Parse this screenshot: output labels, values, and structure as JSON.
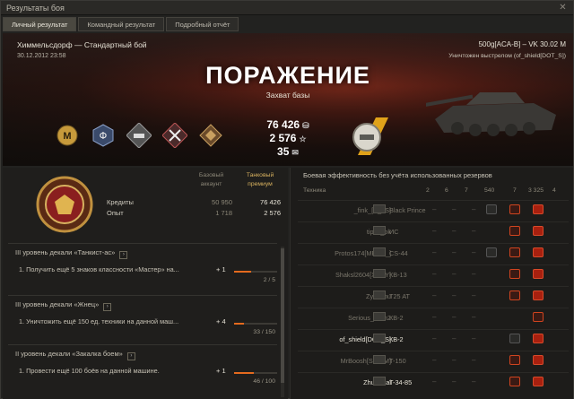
{
  "window": {
    "title": "Результаты боя"
  },
  "tabs": [
    "Личный результат",
    "Командный результат",
    "Подробный отчёт"
  ],
  "banner": {
    "map_mode": "Химмельсдорф — Стандартный бой",
    "datetime": "30.12.2012 23:58",
    "vehicle": "500g[ACA-B] – VK 30.02 M",
    "killed_by": "Уничтожен выстрелом (of_shield[DOT_S])",
    "result": "ПОРАЖЕНИЕ",
    "condition": "Захват базы",
    "credits": "76 426",
    "experience": "2 576",
    "free_exp": "35",
    "medals": [
      "m-badge-icon",
      "phi-medal-icon",
      "tank-medal-icon",
      "crossed-guns-medal-icon",
      "diamond-medal-icon"
    ]
  },
  "earnings": {
    "col_basic": "Базовый аккаунт",
    "col_premium": "Танковый премиум",
    "rows": [
      {
        "label": "Кредиты",
        "basic": "50 950",
        "premium": "76 426"
      },
      {
        "label": "Опыт",
        "basic": "1 718",
        "premium": "2 576"
      }
    ]
  },
  "missions": [
    {
      "title": "III уровень декали «Танкист-ас»",
      "desc": "1. Получить ещё 5 знаков классности «Мастер» на...",
      "plus": "+ 1",
      "count": "2 / 5",
      "progress": 0.4
    },
    {
      "title": "III уровень декали «Жнец»",
      "desc": "1. Уничтожить ещё 150 ед. техники на данной маш...",
      "plus": "+ 4",
      "count": "33 / 150",
      "progress": 0.22
    },
    {
      "title": "II уровень декали «Закалка боем»",
      "desc": "1. Провести ещё 100 боёв на данной машине.",
      "plus": "+ 1",
      "count": "46 / 100",
      "progress": 0.46
    }
  ],
  "team": {
    "title": "Боевая эффективность без учёта использованных резервов",
    "col_vehicle": "Техника",
    "col_values": [
      "2",
      "6",
      "7",
      "540",
      "7",
      "3 325",
      "4"
    ],
    "players": [
      {
        "name": "_fink_[P_LS]",
        "tank": "Black Prince",
        "self": false
      },
      {
        "name": "tipok_ok",
        "tank": "ИС",
        "self": false
      },
      {
        "name": "Protos174[MRCY_]",
        "tank": "CS-44",
        "self": false
      },
      {
        "name": "Shaksl2604[XYNY]",
        "tank": "КВ-13",
        "self": false
      },
      {
        "name": "Zybachu",
        "tank": "T25 AT",
        "self": false
      },
      {
        "name": "Serious_Sam2",
        "tank": "КВ-2",
        "self": false
      },
      {
        "name": "of_shield[DOT_S]",
        "tank": "КВ-2",
        "self": true
      },
      {
        "name": "MrBoosh[SKRIM]",
        "tank": "T-150",
        "self": false
      },
      {
        "name": "Zhurnatai",
        "tank": "T-34-85",
        "self": true
      }
    ]
  },
  "colors": {
    "defeat_red": "#8a2d1d",
    "accent_orange": "#e46a1e",
    "premium_gold": "#d8b25f"
  }
}
